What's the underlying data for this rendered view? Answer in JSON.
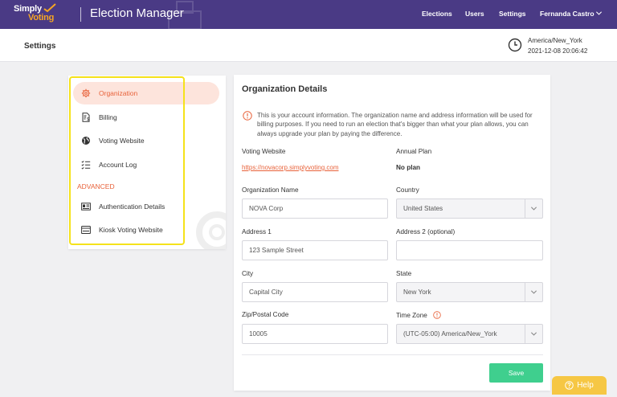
{
  "brand": {
    "logo_line1": "Simply",
    "logo_line2": "Voting",
    "app_title": "Election Manager"
  },
  "nav": {
    "elections": "Elections",
    "users": "Users",
    "settings": "Settings",
    "user_name": "Fernanda Castro"
  },
  "header": {
    "page_title": "Settings",
    "timezone": "America/New_York",
    "datetime": "2021-12-08 20:06:42"
  },
  "sidebar": {
    "items": [
      {
        "label": "Organization",
        "icon": "gear-icon",
        "active": true
      },
      {
        "label": "Billing",
        "icon": "invoice-icon"
      },
      {
        "label": "Voting Website",
        "icon": "globe-icon"
      },
      {
        "label": "Account Log",
        "icon": "checklist-icon"
      }
    ],
    "section_label": "ADVANCED",
    "advanced_items": [
      {
        "label": "Authentication Details",
        "icon": "id-card-icon"
      },
      {
        "label": "Kiosk Voting Website",
        "icon": "kiosk-icon"
      }
    ]
  },
  "org": {
    "title": "Organization Details",
    "info": "This is your account information. The organization name and address information will be used for billing purposes. If you need to run an election that's bigger than what your plan allows, you can always upgrade your plan by paying the difference.",
    "voting_website_label": "Voting Website",
    "voting_website_url": "https://novacorp.simplyvoting.com",
    "annual_plan_label": "Annual Plan",
    "annual_plan_value": "No plan",
    "org_name_label": "Organization Name",
    "org_name_value": "NOVA Corp",
    "country_label": "Country",
    "country_value": "United States",
    "address1_label": "Address 1",
    "address1_value": "123 Sample Street",
    "address2_label": "Address 2 (optional)",
    "address2_value": "",
    "city_label": "City",
    "city_value": "Capital City",
    "state_label": "State",
    "state_value": "New York",
    "zip_label": "Zip/Postal Code",
    "zip_value": "10005",
    "timezone_label": "Time Zone",
    "timezone_value": "(UTC-05:00) America/New_York",
    "save_label": "Save"
  },
  "help": {
    "label": "Help"
  },
  "colors": {
    "topbar": "#4a3a85",
    "accent": "#e8623a",
    "save": "#3fcf8e",
    "help": "#f6c744",
    "highlight": "#f5e21b"
  }
}
